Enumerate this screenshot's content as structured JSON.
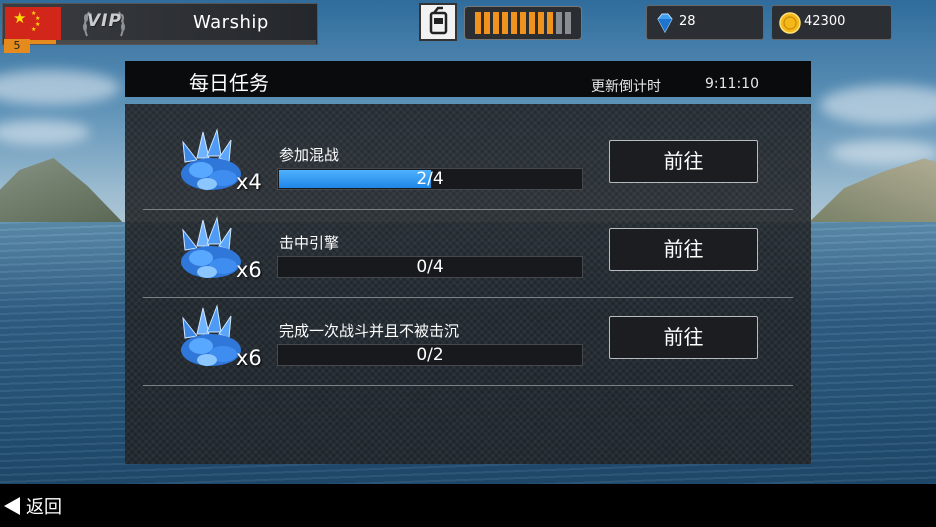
{
  "player": {
    "name": "Warship",
    "level": "5",
    "vip_label": "VIP",
    "xp_fraction": 0.09,
    "flag_icon": "china-flag-icon"
  },
  "fuel": {
    "icon": "fuel-can-icon",
    "filled_segments": 9,
    "total_segments": 11,
    "fill_color": "#f0931e"
  },
  "resources": {
    "gems": {
      "icon": "blue-diamond-icon",
      "value": "28"
    },
    "coins": {
      "icon": "gold-coin-icon",
      "value": "42300"
    }
  },
  "panel": {
    "title": "每日任务",
    "refresh_label": "更新倒计时",
    "refresh_time": "9:11:10"
  },
  "tasks": [
    {
      "name": "参加混战",
      "reward_icon": "blue-crystal-icon",
      "reward": "x4",
      "progress_text": "2/4",
      "progress": 0.5,
      "button": "前往"
    },
    {
      "name": "击中引擎",
      "reward_icon": "blue-crystal-icon",
      "reward": "x6",
      "progress_text": "0/4",
      "progress": 0,
      "button": "前往"
    },
    {
      "name": "完成一次战斗并且不被击沉",
      "reward_icon": "blue-crystal-icon",
      "reward": "x6",
      "progress_text": "0/2",
      "progress": 0,
      "button": "前往"
    }
  ],
  "footer": {
    "back_label": "返回",
    "back_icon": "back-arrow-icon"
  },
  "colors": {
    "progress_fill": "#2f96f0",
    "accent_orange": "#e58a1c"
  }
}
